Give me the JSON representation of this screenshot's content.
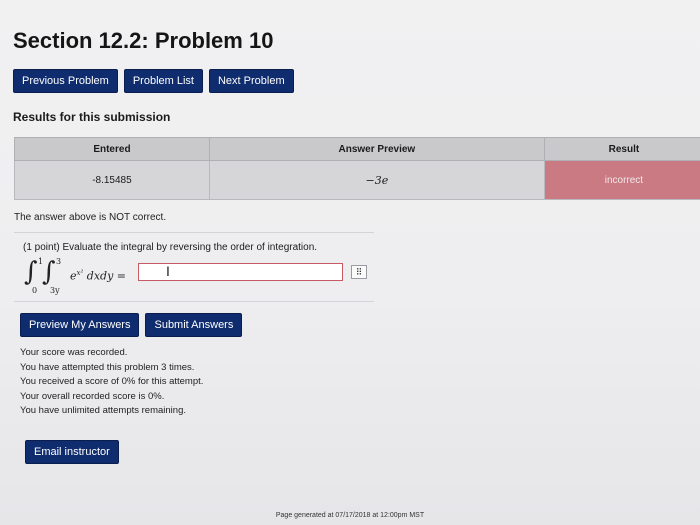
{
  "header": {
    "title": "Section 12.2: Problem 10"
  },
  "nav": {
    "previous_label": "Previous Problem",
    "list_label": "Problem List",
    "next_label": "Next Problem"
  },
  "results": {
    "heading": "Results for this submission",
    "columns": [
      "Entered",
      "Answer Preview",
      "Result"
    ],
    "row": {
      "entered": "-8.15485",
      "preview": "−3e",
      "result": "incorrect"
    }
  },
  "feedback": {
    "not_correct": "The answer above is NOT correct."
  },
  "problem": {
    "prompt": "(1 point) Evaluate the integral by reversing the order of integration.",
    "outer_upper": "1",
    "outer_lower": "0",
    "inner_upper": "3",
    "inner_lower": "3y",
    "integrand": "e",
    "exponent": "x²",
    "differential": "dxdy =",
    "answer_value": "",
    "answer_placeholder": ""
  },
  "buttons": {
    "preview_label": "Preview My Answers",
    "submit_label": "Submit Answers",
    "email_label": "Email instructor"
  },
  "messages": [
    "Your score was recorded.",
    "You have attempted this problem 3 times.",
    "You received a score of 0% for this attempt.",
    "Your overall recorded score is 0%.",
    "You have unlimited attempts remaining."
  ],
  "footer": {
    "text": "Page generated at 07/17/2018 at 12:00pm MST"
  },
  "icons": {
    "grid": "grid-icon",
    "cursor": "text-cursor-icon"
  },
  "colors": {
    "button_bg": "#0f2c6e",
    "incorrect_bg": "#c97a82",
    "header_bg": "#c9c9cc"
  }
}
